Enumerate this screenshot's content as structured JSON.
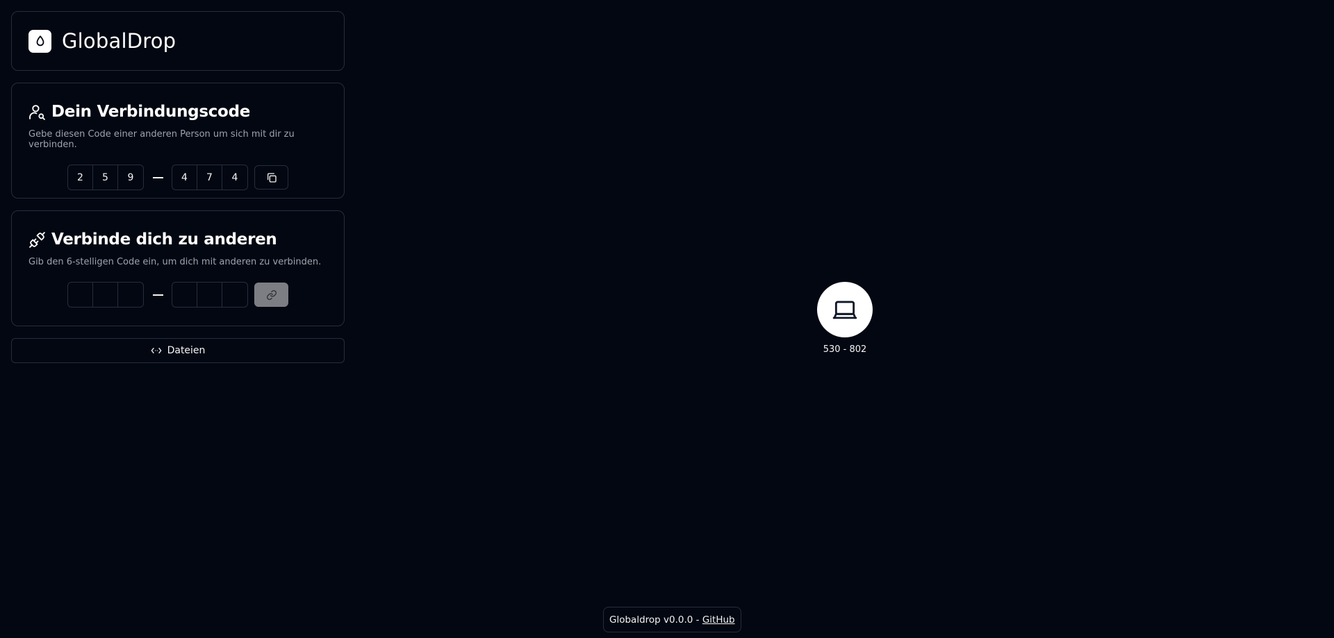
{
  "brand": {
    "title": "GlobalDrop",
    "logo_icon": "drop-icon"
  },
  "my_code": {
    "title": "Dein Verbindungscode",
    "icon": "user-search-icon",
    "description": "Gebe diesen Code einer anderen Person um sich mit dir zu verbinden.",
    "digits_first": [
      "2",
      "5",
      "9"
    ],
    "digits_second": [
      "4",
      "7",
      "4"
    ],
    "copy_icon": "copy-icon"
  },
  "connect": {
    "title": "Verbinde dich zu anderen",
    "icon": "plug-icon",
    "description": "Gib den 6-stelligen Code ein, um dich mit anderen zu verbinden.",
    "digits_first": [
      "",
      "",
      ""
    ],
    "digits_second": [
      "",
      "",
      ""
    ],
    "connect_icon": "link-icon"
  },
  "files_button": {
    "label": "Dateien",
    "icon": "code-arrows-icon"
  },
  "device": {
    "label": "530 - 802",
    "icon": "laptop-icon"
  },
  "footer": {
    "text": "Globaldrop v0.0.0 - ",
    "link_label": "GitHub"
  },
  "colors": {
    "background": "#030712",
    "border": "#262d3c",
    "muted_text": "#9ca3af",
    "disabled_button": "#7d7e84"
  }
}
